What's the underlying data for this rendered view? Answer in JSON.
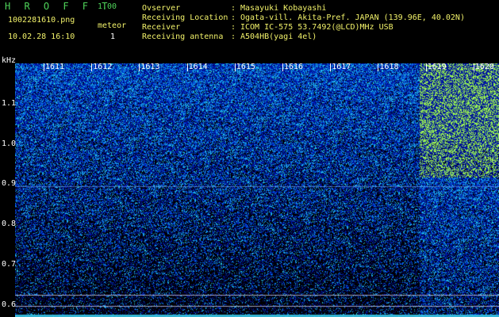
{
  "app": {
    "title": "H R O F F T",
    "version": "1.00",
    "filename": "1002281610.png",
    "datetime": "10.02.28 16:10",
    "count_label": "meteor",
    "count_value": "1"
  },
  "station": {
    "rows": [
      {
        "key": "Ovserver",
        "sep": ":",
        "value": "Masayuki Kobayashi"
      },
      {
        "key": "Receiving Location",
        "sep": ":",
        "value": "Ogata-vill. Akita-Pref. JAPAN (139.96E, 40.02N)"
      },
      {
        "key": "Receiver",
        "sep": ":",
        "value": "ICOM IC-575 53.7492(@LCD)MHz USB"
      },
      {
        "key": "Receiving antenna",
        "sep": ":",
        "value": "A504HB(yagi 4el)"
      }
    ]
  },
  "colors": {
    "label_green": "#4fd35a",
    "label_yellow": "#f2f26a",
    "background": "#000000"
  },
  "chart_data": {
    "type": "heatmap",
    "y_unit": "kHz",
    "y_ticks": [
      "1.1",
      "1.0",
      "0.9",
      "0.8",
      "0.7",
      "0.6"
    ],
    "ylim": [
      0.57,
      1.2
    ],
    "x_ticks": [
      "1611",
      "1612",
      "1613",
      "1614",
      "1615",
      "1616",
      "1617",
      "1618",
      "1619",
      "1620"
    ],
    "grid": false
  }
}
